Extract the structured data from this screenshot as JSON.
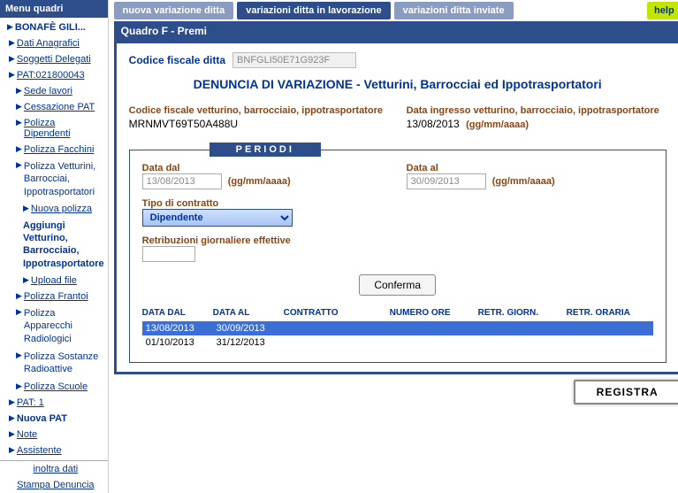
{
  "sidebar": {
    "header": "Menu quadri",
    "items": [
      {
        "label": "BONAFÈ GILI...",
        "lvl": 0,
        "bold": true,
        "nolink": true
      },
      {
        "label": "Dati Anagrafici",
        "lvl": 1
      },
      {
        "label": "Soggetti Delegati",
        "lvl": 1
      },
      {
        "label": "PAT:021800043",
        "lvl": 1
      },
      {
        "label": "Sede lavori",
        "lvl": 2
      },
      {
        "label": "Cessazione PAT",
        "lvl": 2
      },
      {
        "label": "Polizza Dipendenti",
        "lvl": 2
      },
      {
        "label": "Polizza Facchini",
        "lvl": 2
      },
      {
        "label": "Polizza Vetturini, Barrocciai, Ippotrasportatori",
        "lvl": 2,
        "nolink": true,
        "multiline": true
      },
      {
        "label": "Nuova polizza",
        "lvl": 3
      },
      {
        "label": "Aggiungi Vetturino, Barrocciaio, Ippotrasportatore",
        "lvl": 3,
        "bold": true,
        "nolink": true,
        "multiline": true,
        "noarrow": true
      },
      {
        "label": "Upload file",
        "lvl": 3
      },
      {
        "label": "Polizza Frantoi",
        "lvl": 2
      },
      {
        "label": "Polizza Apparecchi Radiologici",
        "lvl": 2,
        "nolink": true,
        "multiline": true
      },
      {
        "label": "Polizza Sostanze Radioattive",
        "lvl": 2,
        "nolink": true,
        "multiline": true
      },
      {
        "label": "Polizza Scuole",
        "lvl": 2
      },
      {
        "label": "PAT: 1",
        "lvl": 1
      },
      {
        "label": "Nuova PAT",
        "lvl": 1,
        "bold": true,
        "nolink": true
      },
      {
        "label": "Note",
        "lvl": 1
      },
      {
        "label": "Assistente",
        "lvl": 1
      }
    ],
    "footer_items": [
      {
        "label": "inoltra dati"
      },
      {
        "label": "Stampa Denuncia"
      }
    ]
  },
  "tabs": [
    {
      "label": "nuova variazione ditta",
      "active": false
    },
    {
      "label": "variazioni ditta in lavorazione",
      "active": true
    },
    {
      "label": "variazioni ditta inviate",
      "active": false
    }
  ],
  "help_label": "help",
  "panel": {
    "header": "Quadro F - Premi",
    "cf_ditta_label": "Codice fiscale ditta",
    "cf_ditta_value": "BNFGLI50E71G923F",
    "title": "DENUNCIA DI VARIAZIONE - Vetturini, Barrocciai ed Ippotrasportatori",
    "cf_vett_label": "Codice fiscale vetturino, barrocciaio, ippotrasportatore",
    "cf_vett_value": "MRNMVT69T50A488U",
    "data_ingr_label": "Data ingresso vetturino, barrocciaio, ippotrasportatore",
    "data_ingr_value": "13/08/2013",
    "date_hint": "(gg/mm/aaaa)"
  },
  "periodi": {
    "title": "PERIODI",
    "data_dal_label": "Data dal",
    "data_dal_value": "13/08/2013",
    "data_al_label": "Data al",
    "data_al_value": "30/09/2013",
    "tipo_label": "Tipo di contratto",
    "tipo_value": "Dipendente",
    "retr_label": "Retribuzioni giornaliere effettive",
    "retr_value": "",
    "conferma_label": "Conferma"
  },
  "table": {
    "headers": [
      "DATA DAL",
      "DATA AL",
      "CONTRATTO",
      "NUMERO ORE",
      "RETR. GIORN.",
      "RETR. ORARIA"
    ],
    "rows": [
      {
        "cells": [
          "13/08/2013",
          "30/09/2013",
          "",
          "",
          "",
          ""
        ],
        "selected": true
      },
      {
        "cells": [
          "01/10/2013",
          "31/12/2013",
          "",
          "",
          "",
          ""
        ],
        "selected": false
      }
    ]
  },
  "registra_label": "REGISTRA"
}
